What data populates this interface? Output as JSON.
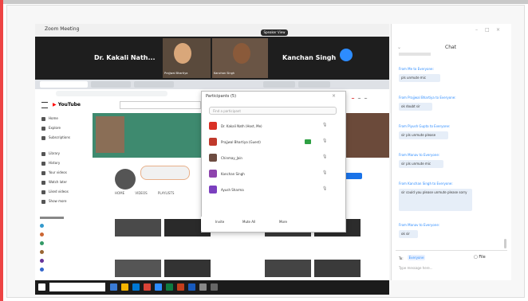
{
  "app": {
    "title": "Zoom Meeting"
  },
  "meeting": {
    "speaker_badge": "Speaker View",
    "participants_strip": [
      {
        "name": "Dr. Kakali Nath..."
      },
      {
        "name": "Prajjwal Bhartiya"
      },
      {
        "name": "Kanchan Singh"
      },
      {
        "name": "Kanchan Singh"
      }
    ]
  },
  "browser": {
    "tab_labels": [
      "",
      "",
      "",
      "",
      "",
      ""
    ],
    "youtube": {
      "logo": "YouTube",
      "channel_name": "",
      "subscribe": "",
      "tabs": [
        "HOME",
        "VIDEOS",
        "PLAYLISTS",
        "CHANNELS",
        "ABOUT"
      ],
      "sidebar": [
        "Home",
        "Explore",
        "Subscriptions",
        "Library",
        "History",
        "Your videos",
        "Watch later",
        "Liked videos",
        "Show more"
      ]
    }
  },
  "participants_popup": {
    "title": "Participants (5)",
    "search_placeholder": "Find a participant",
    "rows": [
      {
        "name": "Dr. Kakali Nath (Host, Me)",
        "color": "#d93025"
      },
      {
        "name": "Prajjwal Bhartiya (Guest)",
        "color": "#c0392b"
      },
      {
        "name": "Chinmay_Jain",
        "color": "#6d4c41"
      },
      {
        "name": "Kanchan Singh",
        "color": "#8e44ad"
      },
      {
        "name": "Ayush Sharma",
        "color": "#7b3fbf"
      }
    ],
    "footer": [
      "Invite",
      "Mute All",
      "More"
    ]
  },
  "chat": {
    "title": "Chat",
    "messages": [
      {
        "from": "From Me to Everyone:",
        "text": "pls unmute mic"
      },
      {
        "from": "From Prajjwal Bhartiya to Everyone:",
        "text": "ok doubt sir"
      },
      {
        "from": "From Piyush Gupta to Everyone:",
        "text": "sir pls unmute please"
      },
      {
        "from": "From Manav to Everyone:",
        "text": "sir pls unmute mic"
      },
      {
        "from": "From Kanchan Singh to Everyone:",
        "text": "sir could you please unmute please sorry"
      },
      {
        "from": "From Manav to Everyone:",
        "text": "ok sir"
      }
    ],
    "to_label": "To:",
    "to_value": "Everyone",
    "file_label": "File",
    "input_placeholder": "Type message here..."
  },
  "taskbar": {
    "time": "",
    "date": ""
  },
  "colors": {
    "zoom_blue": "#2d8cff",
    "video_strip": "#1e1e1e",
    "taskbar": "#1b1b1b",
    "youtube_red": "#ff0000"
  }
}
